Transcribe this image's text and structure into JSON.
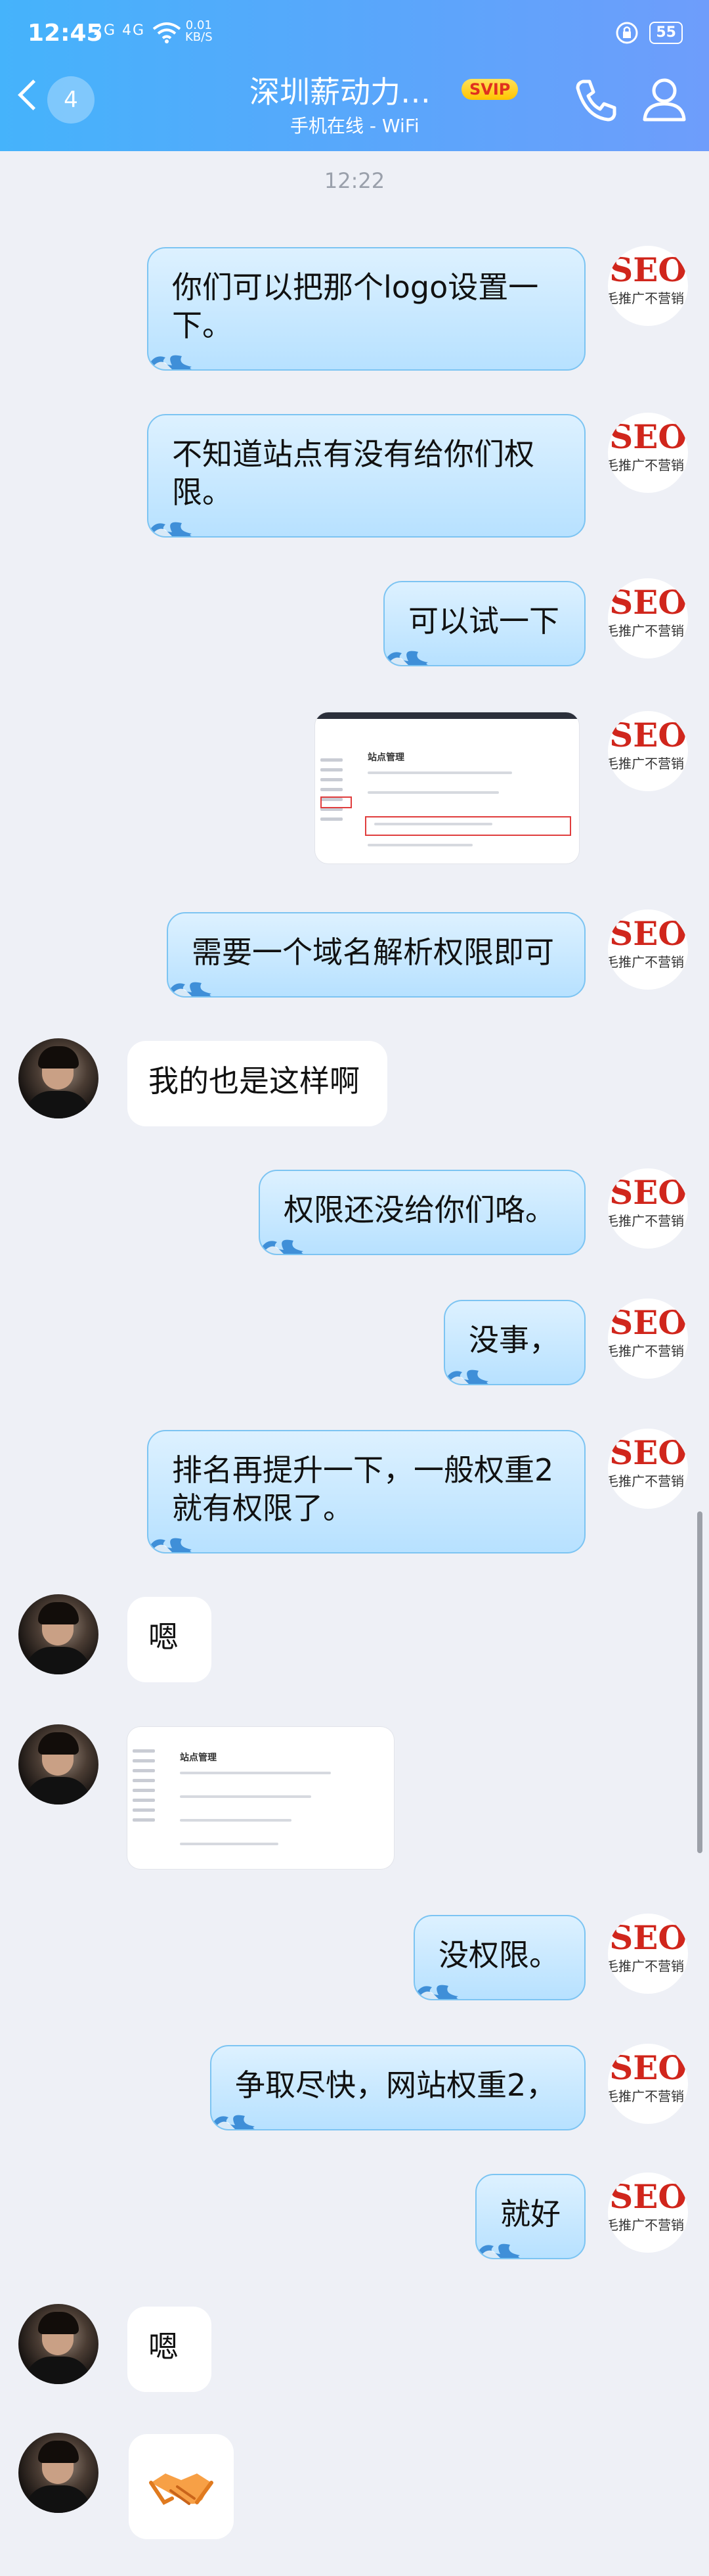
{
  "status_bar": {
    "time": "12:45",
    "network": "2G 4G",
    "speed_value": "0.01",
    "speed_unit": "KB/S",
    "battery": "55"
  },
  "header": {
    "unread_count": "4",
    "title": "深圳薪动力…",
    "badge": "SVIP",
    "subtitle": "手机在线 - WiFi"
  },
  "timestamp": "12:22",
  "seo_avatar": {
    "main": "SEO",
    "sub": "毛推广不营销"
  },
  "messages": [
    {
      "side": "out",
      "type": "text",
      "text": "你们可以把那个logo设置一下。"
    },
    {
      "side": "out",
      "type": "text",
      "text": "不知道站点有没有给你们权限。"
    },
    {
      "side": "out",
      "type": "text",
      "text": "可以试一下"
    },
    {
      "side": "out",
      "type": "image",
      "image_title": "站点管理"
    },
    {
      "side": "out",
      "type": "text",
      "text": "需要一个域名解析权限即可"
    },
    {
      "side": "in",
      "type": "text",
      "text": "我的也是这样啊"
    },
    {
      "side": "out",
      "type": "text",
      "text": "权限还没给你们咯。"
    },
    {
      "side": "out",
      "type": "text",
      "text": "没事，"
    },
    {
      "side": "out",
      "type": "text",
      "text": "排名再提升一下，一般权重2就有权限了。"
    },
    {
      "side": "in",
      "type": "text",
      "text": "嗯"
    },
    {
      "side": "in",
      "type": "image",
      "image_title": "站点管理"
    },
    {
      "side": "out",
      "type": "text",
      "text": "没权限。"
    },
    {
      "side": "out",
      "type": "text",
      "text": "争取尽快，网站权重2，"
    },
    {
      "side": "out",
      "type": "text",
      "text": "就好"
    },
    {
      "side": "in",
      "type": "text",
      "text": "嗯"
    },
    {
      "side": "in",
      "type": "emoji",
      "emoji": "handshake-emoji"
    }
  ],
  "colors": {
    "header_start": "#45b3fb",
    "header_end": "#6e9dfb",
    "bubble_out": "#b7e1ff",
    "seo_red": "#d0261c",
    "svip_gold": "#ffc400"
  }
}
